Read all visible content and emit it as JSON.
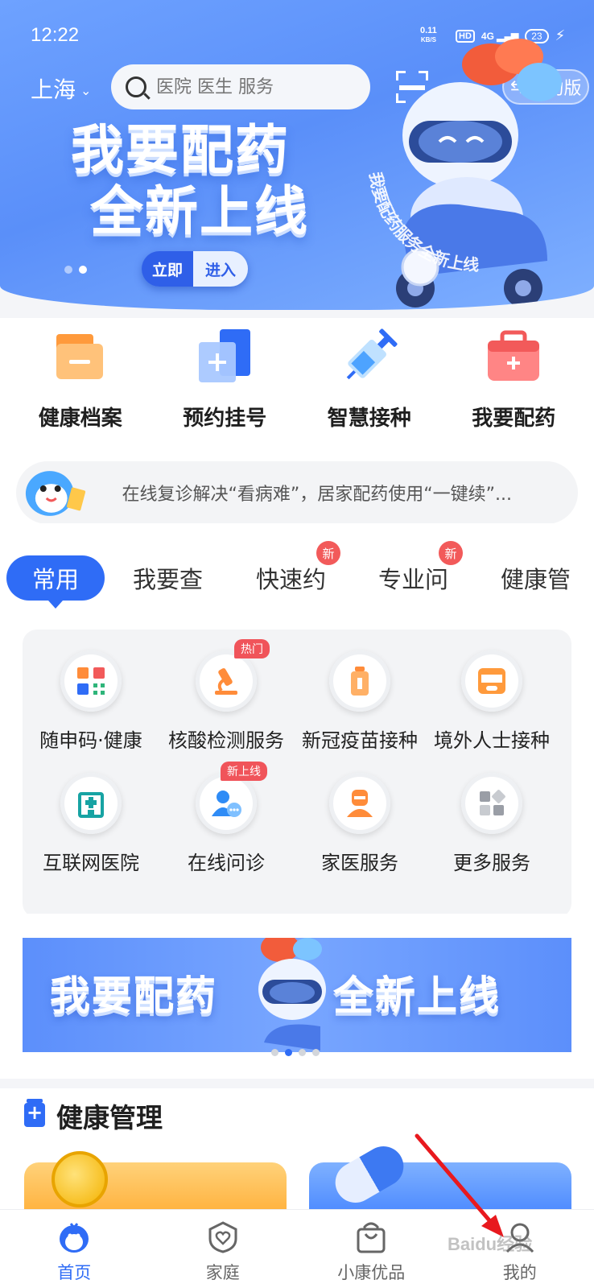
{
  "status_bar": {
    "time": "12:22",
    "speed": "0.11",
    "speed_unit": "KB/S",
    "hd": "HD",
    "signal": "4G",
    "battery": "23"
  },
  "header": {
    "city": "上海",
    "search_placeholder": "医院 医生 服务",
    "simple_mode": "简约版"
  },
  "hero": {
    "title_line1": "我要配药",
    "title_line2": "全新上线",
    "btn_left": "立即",
    "btn_right": "进入",
    "ring_text": "我要配药服务全新上线"
  },
  "quick_actions": [
    {
      "label": "健康档案",
      "icon": "folder-icon"
    },
    {
      "label": "预约挂号",
      "icon": "register-icon"
    },
    {
      "label": "智慧接种",
      "icon": "syringe-icon"
    },
    {
      "label": "我要配药",
      "icon": "medkit-icon"
    }
  ],
  "notice": {
    "text": "在线复诊解决“看病难”，居家配药使用“一键续”..."
  },
  "tabs": [
    {
      "label": "常用",
      "active": true,
      "badge": ""
    },
    {
      "label": "我要查",
      "active": false,
      "badge": ""
    },
    {
      "label": "快速约",
      "active": false,
      "badge": "新"
    },
    {
      "label": "专业问",
      "active": false,
      "badge": "新"
    },
    {
      "label": "健康管",
      "active": false,
      "badge": ""
    }
  ],
  "services": [
    {
      "label": "随申码·健康",
      "icon": "qr-code-icon",
      "tag": ""
    },
    {
      "label": "核酸检测服务",
      "icon": "microscope-icon",
      "tag": "热门"
    },
    {
      "label": "新冠疫苗接种",
      "icon": "vaccine-bottle-icon",
      "tag": ""
    },
    {
      "label": "境外人士接种",
      "icon": "covid-vaccine-icon",
      "tag": ""
    },
    {
      "label": "互联网医院",
      "icon": "hospital-icon",
      "tag": ""
    },
    {
      "label": "在线问诊",
      "icon": "doctor-chat-icon",
      "tag": "新上线"
    },
    {
      "label": "家医服务",
      "icon": "family-doctor-icon",
      "tag": ""
    },
    {
      "label": "更多服务",
      "icon": "more-grid-icon",
      "tag": ""
    }
  ],
  "banner2": {
    "left": "我要配药",
    "right": "全新上线"
  },
  "health_section": {
    "title": "健康管理"
  },
  "bottom_nav": [
    {
      "label": "首页",
      "active": true
    },
    {
      "label": "家庭",
      "active": false
    },
    {
      "label": "小康优品",
      "active": false
    },
    {
      "label": "我的",
      "active": false
    }
  ],
  "watermark": "Baidu经验",
  "colors": {
    "primary": "#2f6cf6",
    "badge_red": "#f25a5a",
    "hero_blue": "#5a8ff9"
  }
}
